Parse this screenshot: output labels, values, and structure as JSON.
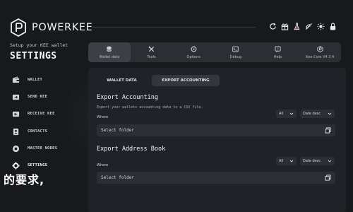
{
  "header": {
    "brand": "POWERKEE",
    "icons": [
      "refresh-icon",
      "gift-icon",
      "flask-icon",
      "broadcast-off-icon",
      "sun-icon",
      "lock-icon"
    ]
  },
  "sidebar": {
    "setup_text": "Setup your KEE wallet",
    "title": "SETTINGS",
    "items": [
      {
        "label": "WALLET",
        "icon": "wallet-icon"
      },
      {
        "label": "SEND KEE",
        "icon": "send-icon"
      },
      {
        "label": "RECEIVE KEE",
        "icon": "receive-icon"
      },
      {
        "label": "CONTACTS",
        "icon": "contacts-icon"
      },
      {
        "label": "MASTER NODES",
        "icon": "master-nodes-icon"
      },
      {
        "label": "SETTINGS",
        "icon": "settings-icon"
      }
    ]
  },
  "overlay_text": "的要求,",
  "tabs": [
    {
      "label": "Wallet data",
      "icon": "database-icon",
      "active": true
    },
    {
      "label": "Tools",
      "icon": "tools-icon",
      "active": false
    },
    {
      "label": "Options",
      "icon": "options-icon",
      "active": false
    },
    {
      "label": "Debug",
      "icon": "debug-icon",
      "active": false
    },
    {
      "label": "Help",
      "icon": "help-icon",
      "active": false
    },
    {
      "label": "Kee Core V4.3.4",
      "icon": "kee-core-icon",
      "active": false
    }
  ],
  "subtabs": [
    "WALLET DATA",
    "EXPORT ACCOUNTING"
  ],
  "export_accounting": {
    "title": "Export Accounting",
    "desc": "Export your wallets accounting data to a CSV file.",
    "where": "Where",
    "filter_all": "All",
    "filter_sort": "Date desc",
    "folder_placeholder": "Select folder"
  },
  "export_address_book": {
    "title": "Export Address Book",
    "where": "Where",
    "filter_all": "All",
    "filter_sort": "Date desc",
    "folder_placeholder": "Select folder"
  },
  "colors": {
    "background": "#17191c",
    "panel": "#1f2226",
    "field": "#2b2e33",
    "text": "#e9ecef"
  }
}
